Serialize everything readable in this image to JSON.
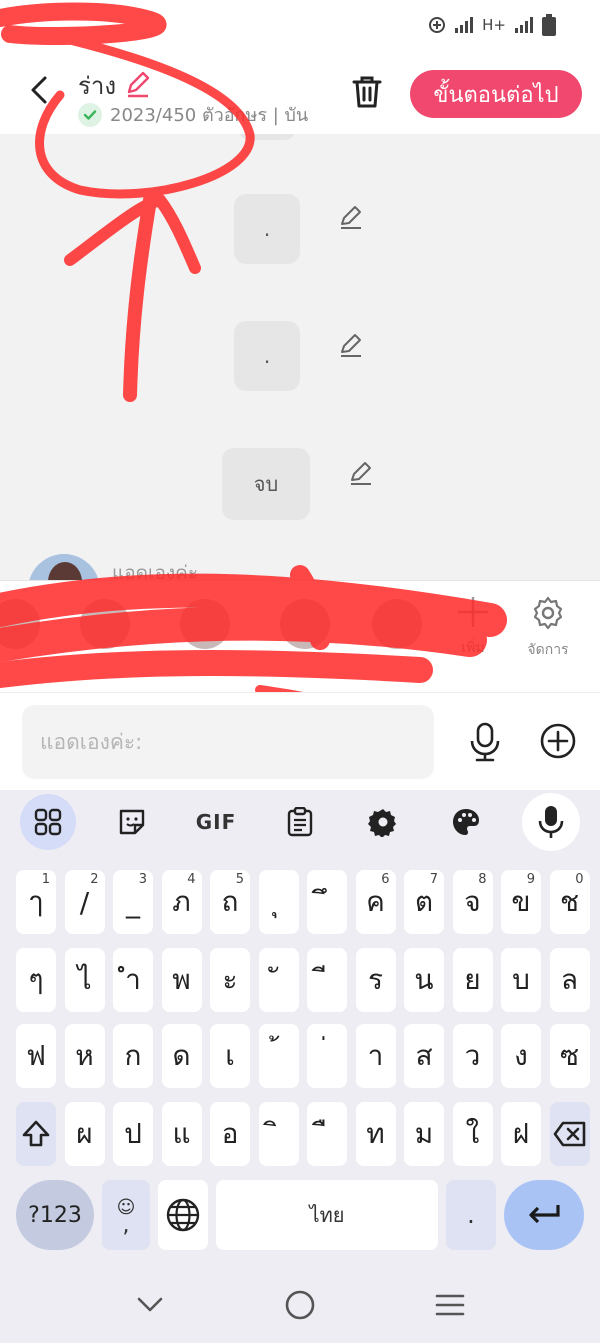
{
  "status_bar": {
    "network_label": "H+"
  },
  "header": {
    "title": "ร่าง",
    "subtitle": "2023/450 ตัวอักษร | บัน",
    "next_button_label": "ขั้นตอนต่อไป"
  },
  "messages": {
    "items": [
      {
        "text": "."
      },
      {
        "text": "."
      },
      {
        "text": "จบ"
      }
    ],
    "sender_name": "แอดเองค่ะ"
  },
  "character_bar": {
    "add_label": "เพิ่ม",
    "manage_label": "จัดการ"
  },
  "composer": {
    "placeholder": "แอดเองค่ะ:"
  },
  "keyboard": {
    "toolbar": {
      "gif_label": "GIF"
    },
    "row1": [
      {
        "char": "ๅ",
        "hint": "1"
      },
      {
        "char": "/",
        "hint": "2"
      },
      {
        "char": "_",
        "hint": "3"
      },
      {
        "char": "ภ",
        "hint": "4"
      },
      {
        "char": "ถ",
        "hint": "5"
      },
      {
        "char": "ุ",
        "hint": ""
      },
      {
        "char": "ึ",
        "hint": ""
      },
      {
        "char": "ค",
        "hint": "6"
      },
      {
        "char": "ต",
        "hint": "7"
      },
      {
        "char": "จ",
        "hint": "8"
      },
      {
        "char": "ข",
        "hint": "9"
      },
      {
        "char": "ช",
        "hint": "0"
      }
    ],
    "row2": [
      "ๆ",
      "ไ",
      "ำ",
      "พ",
      "ะ",
      "ั",
      "ี",
      "ร",
      "น",
      "ย",
      "บ",
      "ล"
    ],
    "row3": [
      "ฟ",
      "ห",
      "ก",
      "ด",
      "เ",
      "้",
      "่",
      "า",
      "ส",
      "ว",
      "ง",
      "ซ"
    ],
    "row4": [
      "ผ",
      "ป",
      "แ",
      "อ",
      "ิ",
      "ื",
      "ท",
      "ม",
      "ใ",
      "ฝ"
    ],
    "sym_label": "?123",
    "emoji_label": "☺",
    "emoji_sub": ",",
    "space_label": "ไทย",
    "period_label": "."
  },
  "colors": {
    "accent": "#f0486e",
    "enter": "#a9c3f5",
    "scribble": "#ff2a2a"
  }
}
